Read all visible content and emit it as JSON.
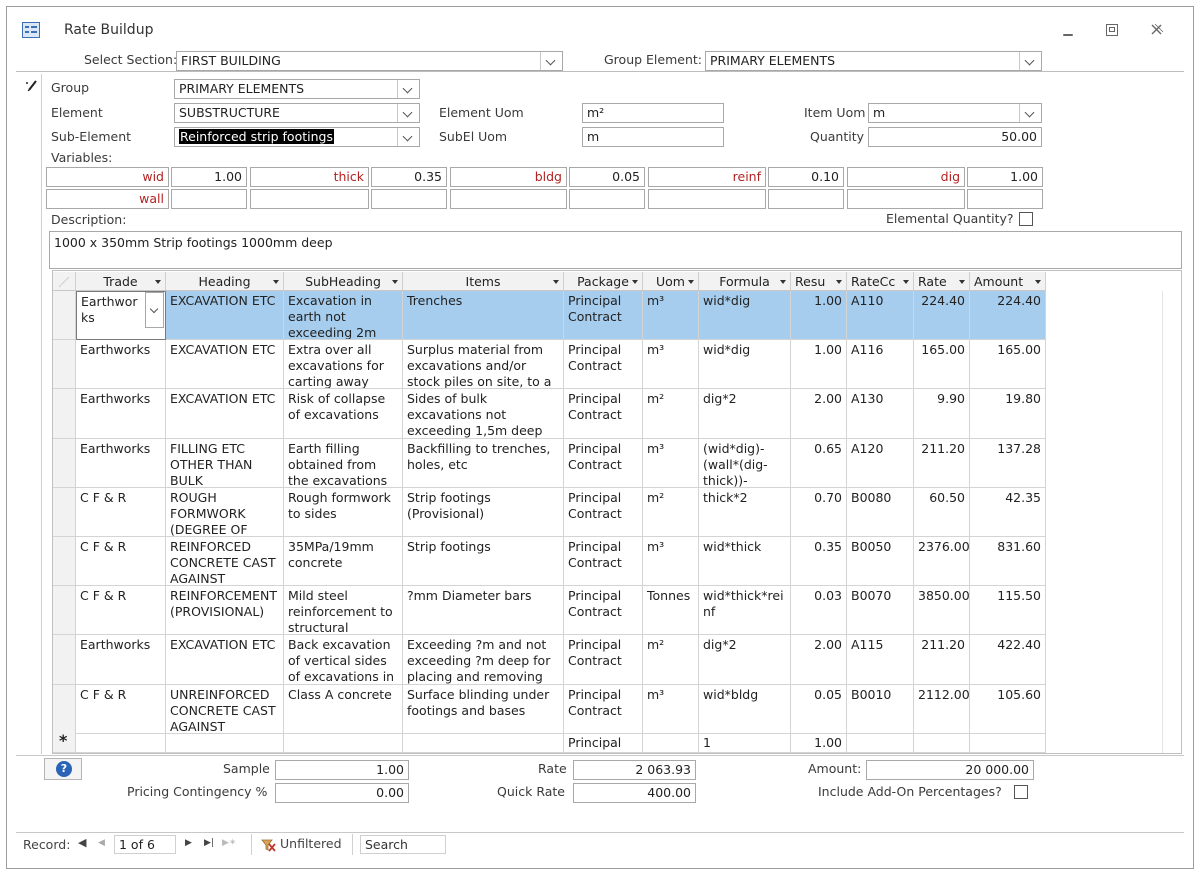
{
  "window": {
    "title": "Rate Buildup"
  },
  "top": {
    "select_section_label": "Select Section:",
    "select_section_value": "FIRST BUILDING",
    "group_element_label": "Group Element:",
    "group_element_value": "PRIMARY ELEMENTS"
  },
  "form": {
    "group_label": "Group",
    "group_value": "PRIMARY ELEMENTS",
    "element_label": "Element",
    "element_value": "SUBSTRUCTURE",
    "subelement_label": "Sub-Element",
    "subelement_value": "Reinforced strip footings",
    "element_uom_label": "Element Uom",
    "element_uom_value": "m²",
    "subel_uom_label": "SubEl Uom",
    "subel_uom_value": "m",
    "item_uom_label": "Item Uom",
    "item_uom_value": "m",
    "quantity_label": "Quantity",
    "quantity_value": "50.00",
    "variables_label": "Variables:",
    "variables_row1": [
      {
        "name": "wid",
        "value": "1.00"
      },
      {
        "name": "thick",
        "value": "0.35"
      },
      {
        "name": "bldg",
        "value": "0.05"
      },
      {
        "name": "reinf",
        "value": "0.10"
      },
      {
        "name": "dig",
        "value": "1.00"
      }
    ],
    "variables_row2_name": "wall",
    "description_label": "Description:",
    "elemental_quantity_label": "Elemental Quantity?",
    "description_value": "1000 x 350mm Strip footings 1000mm deep"
  },
  "grid": {
    "columns": [
      "Trade",
      "Heading",
      "SubHeading",
      "Items",
      "Package",
      "Uom",
      "Formula",
      "Resu",
      "RateCc",
      "Rate",
      "Amount"
    ],
    "rows": [
      {
        "trade": "Earthwor ks",
        "heading": "EXCAVATION ETC",
        "subheading": "Excavation in earth not exceeding 2m",
        "items": "Trenches",
        "package": "Principal Contract",
        "uom": "m³",
        "formula": "wid*dig",
        "result": "1.00",
        "ratecode": "A110",
        "rate": "224.40",
        "amount": "224.40"
      },
      {
        "trade": "Earthworks",
        "heading": "EXCAVATION ETC",
        "subheading": "Extra over all excavations for carting away",
        "items": "Surplus material from excavations and/or stock piles on site, to a",
        "package": "Principal Contract",
        "uom": "m³",
        "formula": "wid*dig",
        "result": "1.00",
        "ratecode": "A116",
        "rate": "165.00",
        "amount": "165.00"
      },
      {
        "trade": "Earthworks",
        "heading": "EXCAVATION ETC",
        "subheading": "Risk of collapse of excavations",
        "items": "Sides of bulk excavations not exceeding 1,5m deep",
        "package": "Principal Contract",
        "uom": "m²",
        "formula": "dig*2",
        "result": "2.00",
        "ratecode": "A130",
        "rate": "9.90",
        "amount": "19.80"
      },
      {
        "trade": "Earthworks",
        "heading": "FILLING ETC OTHER THAN BULK",
        "subheading": "Earth filling obtained from the excavations",
        "items": "Backfilling to trenches, holes, etc",
        "package": "Principal Contract",
        "uom": "m³",
        "formula": "(wid*dig)-(wall*(dig-thick))-",
        "result": "0.65",
        "ratecode": "A120",
        "rate": "211.20",
        "amount": "137.28"
      },
      {
        "trade": "C F & R",
        "heading": "ROUGH FORMWORK (DEGREE OF",
        "subheading": "Rough formwork to sides",
        "items": "Strip footings (Provisional)",
        "package": "Principal Contract",
        "uom": "m²",
        "formula": "thick*2",
        "result": "0.70",
        "ratecode": "B0080",
        "rate": "60.50",
        "amount": "42.35"
      },
      {
        "trade": "C F & R",
        "heading": "REINFORCED CONCRETE CAST AGAINST",
        "subheading": "35MPa/19mm concrete",
        "items": "Strip footings",
        "package": "Principal Contract",
        "uom": "m³",
        "formula": "wid*thick",
        "result": "0.35",
        "ratecode": "B0050",
        "rate": "2376.00",
        "amount": "831.60"
      },
      {
        "trade": "C F & R",
        "heading": "REINFORCEMENT (PROVISIONAL)",
        "subheading": "Mild steel reinforcement to structural",
        "items": "?mm Diameter bars",
        "package": "Principal Contract",
        "uom": "Tonnes",
        "formula": "wid*thick*rei nf",
        "result": "0.03",
        "ratecode": "B0070",
        "rate": "3850.00",
        "amount": "115.50"
      },
      {
        "trade": "Earthworks",
        "heading": "EXCAVATION ETC",
        "subheading": "Back excavation of vertical sides of excavations in",
        "items": "Exceeding ?m and not exceeding ?m deep for placing and removing",
        "package": "Principal Contract",
        "uom": "m²",
        "formula": "dig*2",
        "result": "2.00",
        "ratecode": "A115",
        "rate": "211.20",
        "amount": "422.40"
      },
      {
        "trade": "C F & R",
        "heading": "UNREINFORCED CONCRETE CAST AGAINST",
        "subheading": "Class A concrete",
        "items": "Surface blinding under footings and bases",
        "package": "Principal Contract",
        "uom": "m³",
        "formula": "wid*bldg",
        "result": "0.05",
        "ratecode": "B0010",
        "rate": "2112.00",
        "amount": "105.60"
      }
    ],
    "new_row": {
      "package": "Principal",
      "formula": "1",
      "result": "1.00"
    }
  },
  "footer": {
    "sample_label": "Sample",
    "sample_value": "1.00",
    "pricing_contingency_label": "Pricing Contingency %",
    "pricing_contingency_value": "0.00",
    "rate_label": "Rate",
    "rate_value": "2 063.93",
    "quick_rate_label": "Quick Rate",
    "quick_rate_value": "400.00",
    "amount_label": "Amount:",
    "amount_value": "20 000.00",
    "include_addon_label": "Include Add-On Percentages?"
  },
  "navbar": {
    "record_label": "Record:",
    "record_value": "1 of 6",
    "filter_label": "Unfiltered",
    "search_label": "Search"
  }
}
